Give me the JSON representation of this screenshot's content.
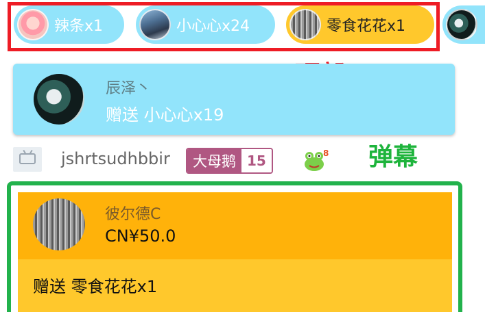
{
  "ticker": {
    "label": "顶部ticker",
    "items": [
      {
        "text": "辣条x1",
        "color": "#92e4fb",
        "avatar": "anime-girl-avatar"
      },
      {
        "text": "小心心x24",
        "color": "#92e4fb",
        "avatar": "scenery-avatar"
      },
      {
        "text": "零食花花x1",
        "color": "#ffc82c",
        "avatar": "gray-texture-avatar"
      },
      {
        "text": "",
        "color": "#92e4fb",
        "avatar": "wolf-avatar"
      }
    ]
  },
  "gift": {
    "user": "辰泽丶",
    "action": "赠送 小心心x19",
    "color": "#92e4fb"
  },
  "danmaku": {
    "label": "弹幕",
    "username": "jshrtsudhbbir",
    "medal": {
      "name": "大母鹅",
      "level": "15",
      "color": "#b05782"
    },
    "emote": "frog-emote-icon"
  },
  "superchat": {
    "user": "彼尔德C",
    "price": "CN¥50.0",
    "message": "赠送 零食花花x1",
    "colors": {
      "top": "#ffb20a",
      "bottom": "#ffc82c"
    }
  },
  "annotation_colors": {
    "ticker": "#ee1c25",
    "superchat": "#22b24c",
    "danmaku_label": "#1eb43c"
  }
}
